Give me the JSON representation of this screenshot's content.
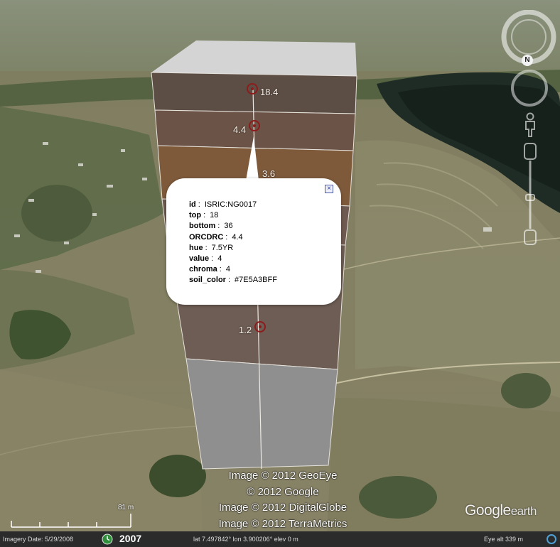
{
  "soil_layers": [
    {
      "value": "18.4"
    },
    {
      "value": "4.4"
    },
    {
      "value": "3.6"
    },
    {
      "value": "1.2"
    }
  ],
  "balloon": {
    "close_icon": "close-icon",
    "fields": [
      {
        "key": "id",
        "value": "ISRIC:NG0017"
      },
      {
        "key": "top",
        "value": "18"
      },
      {
        "key": "bottom",
        "value": "36"
      },
      {
        "key": "ORCDRC",
        "value": "4.4"
      },
      {
        "key": "hue",
        "value": "7.5YR"
      },
      {
        "key": "value",
        "value": "4"
      },
      {
        "key": "chroma",
        "value": "4"
      },
      {
        "key": "soil_color",
        "value": "#7E5A3BFF"
      }
    ]
  },
  "attribution": {
    "line1": "Image © 2012 GeoEye",
    "line2": "© 2012 Google",
    "line3": "Image © 2012 DigitalGlobe",
    "line4": "Image © 2012 TerraMetrics"
  },
  "logo": {
    "google": "Google",
    "earth": "earth"
  },
  "scale": {
    "label": "81 m"
  },
  "navigation": {
    "north_label": "N",
    "icons": [
      "compass-ring-icon",
      "look-joystick-icon",
      "move-joystick-icon",
      "street-view-pegman-icon",
      "zoom-slider-icon"
    ]
  },
  "statusbar": {
    "imagery_date": "Imagery Date: 5/29/2008",
    "year": "2007",
    "lat": "lat   7.497842°  lon   3.900206°  elev    0 m",
    "eye_alt": "Eye alt    339 m"
  },
  "colors": {
    "soil_top": "#5d4e45",
    "soil_mid": "#7e5a3b",
    "soil_bottom": "#6e5e55",
    "empty_layer": "#8f8f8f",
    "marker": "#8e1b1b"
  }
}
